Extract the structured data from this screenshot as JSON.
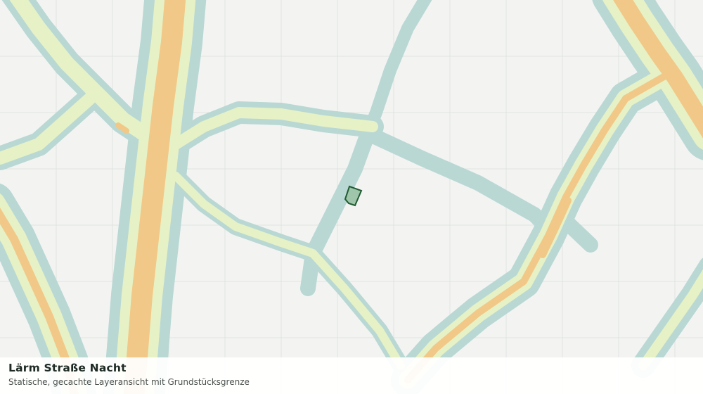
{
  "map": {
    "layer_title": "Lärm Straße Nacht",
    "layer_subtitle": "Statische, gecachte Layeransicht mit Grundstücksgrenze",
    "grid": true,
    "colors": {
      "background": "#f3f4f2",
      "grid_line": "#dfe3e0",
      "noise_outer": "#b9d8d4",
      "noise_middle": "#e6f2c6",
      "noise_high": "#f1c887",
      "parcel_fill": "#9fc5ab",
      "parcel_border": "#1f5c33"
    }
  }
}
